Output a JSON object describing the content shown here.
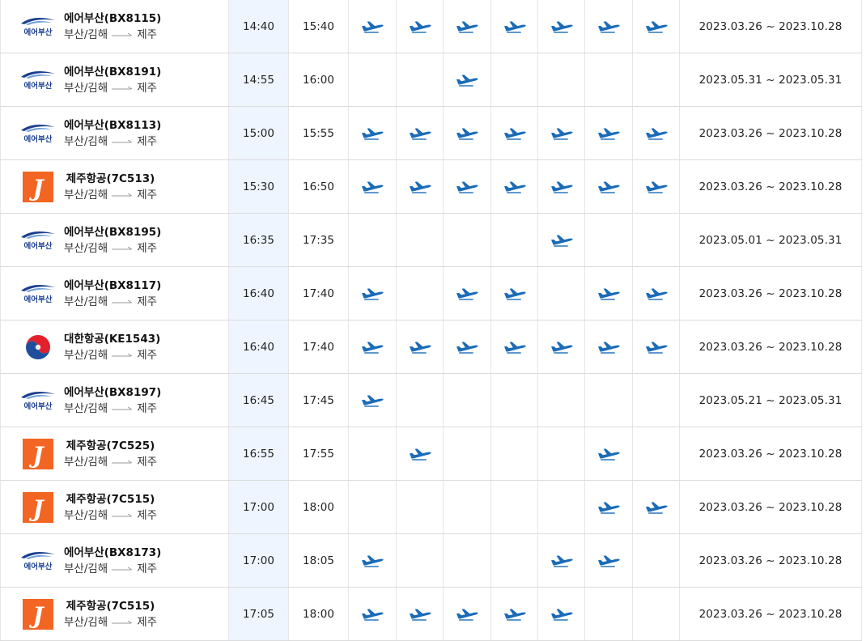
{
  "colors": {
    "plane": "#1a6bb8",
    "dep_bg": "#eef5fe",
    "airbusan_navy": "#1b3f8e",
    "jeju_orange": "#f26522"
  },
  "flights": [
    {
      "airline": "airbusan",
      "name": "에어부산(BX8115)",
      "origin": "부산/김해",
      "dest": "제주",
      "dep": "14:40",
      "arr": "15:40",
      "days": [
        true,
        true,
        true,
        true,
        true,
        true,
        true
      ],
      "period": "2023.03.26 ~ 2023.10.28"
    },
    {
      "airline": "airbusan",
      "name": "에어부산(BX8191)",
      "origin": "부산/김해",
      "dest": "제주",
      "dep": "14:55",
      "arr": "16:00",
      "days": [
        false,
        false,
        true,
        false,
        false,
        false,
        false
      ],
      "period": "2023.05.31 ~ 2023.05.31"
    },
    {
      "airline": "airbusan",
      "name": "에어부산(BX8113)",
      "origin": "부산/김해",
      "dest": "제주",
      "dep": "15:00",
      "arr": "15:55",
      "days": [
        true,
        true,
        true,
        true,
        true,
        true,
        true
      ],
      "period": "2023.03.26 ~ 2023.10.28"
    },
    {
      "airline": "jejuair",
      "name": "제주항공(7C513)",
      "origin": "부산/김해",
      "dest": "제주",
      "dep": "15:30",
      "arr": "16:50",
      "days": [
        true,
        true,
        true,
        true,
        true,
        true,
        true
      ],
      "period": "2023.03.26 ~ 2023.10.28"
    },
    {
      "airline": "airbusan",
      "name": "에어부산(BX8195)",
      "origin": "부산/김해",
      "dest": "제주",
      "dep": "16:35",
      "arr": "17:35",
      "days": [
        false,
        false,
        false,
        false,
        true,
        false,
        false
      ],
      "period": "2023.05.01 ~ 2023.05.31"
    },
    {
      "airline": "airbusan",
      "name": "에어부산(BX8117)",
      "origin": "부산/김해",
      "dest": "제주",
      "dep": "16:40",
      "arr": "17:40",
      "days": [
        true,
        false,
        true,
        true,
        false,
        true,
        true
      ],
      "period": "2023.03.26 ~ 2023.10.28"
    },
    {
      "airline": "koreanair",
      "name": "대한항공(KE1543)",
      "origin": "부산/김해",
      "dest": "제주",
      "dep": "16:40",
      "arr": "17:40",
      "days": [
        true,
        true,
        true,
        true,
        true,
        true,
        true
      ],
      "period": "2023.03.26 ~ 2023.10.28"
    },
    {
      "airline": "airbusan",
      "name": "에어부산(BX8197)",
      "origin": "부산/김해",
      "dest": "제주",
      "dep": "16:45",
      "arr": "17:45",
      "days": [
        true,
        false,
        false,
        false,
        false,
        false,
        false
      ],
      "period": "2023.05.21 ~ 2023.05.31"
    },
    {
      "airline": "jejuair",
      "name": "제주항공(7C525)",
      "origin": "부산/김해",
      "dest": "제주",
      "dep": "16:55",
      "arr": "17:55",
      "days": [
        false,
        true,
        false,
        false,
        false,
        true,
        false
      ],
      "period": "2023.03.26 ~ 2023.10.28"
    },
    {
      "airline": "jejuair",
      "name": "제주항공(7C515)",
      "origin": "부산/김해",
      "dest": "제주",
      "dep": "17:00",
      "arr": "18:00",
      "days": [
        false,
        false,
        false,
        false,
        false,
        true,
        true
      ],
      "period": "2023.03.26 ~ 2023.10.28"
    },
    {
      "airline": "airbusan",
      "name": "에어부산(BX8173)",
      "origin": "부산/김해",
      "dest": "제주",
      "dep": "17:00",
      "arr": "18:05",
      "days": [
        true,
        false,
        false,
        false,
        true,
        true,
        false
      ],
      "period": "2023.03.26 ~ 2023.10.28"
    },
    {
      "airline": "jejuair",
      "name": "제주항공(7C515)",
      "origin": "부산/김해",
      "dest": "제주",
      "dep": "17:05",
      "arr": "18:00",
      "days": [
        true,
        true,
        true,
        true,
        true,
        false,
        false
      ],
      "period": "2023.03.26 ~ 2023.10.28"
    }
  ],
  "logo_text": {
    "airbusan": "에어부산",
    "jejuair": "J"
  }
}
